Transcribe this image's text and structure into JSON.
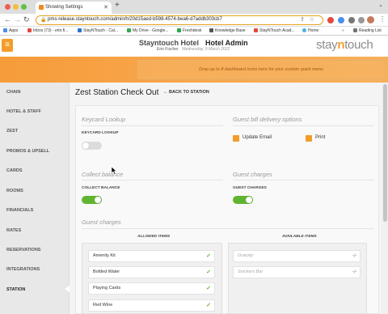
{
  "browser": {
    "tab_title": "Showing Settings",
    "url": "pms-release.stayntouch.com/admin/h/20d15aed-b598-4574-bea6-d7addb303cb7",
    "bookmarks": [
      "Apps",
      "Inbox (73) - erin.fi...",
      "StayNTouch - Cal...",
      "My Drive - Google...",
      "Freshdesk",
      "Knowledge Base",
      "StayNTouch Acad...",
      "Home",
      "Reading List"
    ]
  },
  "header": {
    "hotel_name": "Stayntouch Hotel",
    "admin_label": "Hotel Admin",
    "user_name": "Erin Fischer",
    "date": "Wednesday, 9 March 2022",
    "logo_prefix": "stay",
    "logo_n": "n",
    "logo_suffix": "touch",
    "banner_text": "Drop up to 8 dashboard icons here for your custom quick menu"
  },
  "sidebar": {
    "items": [
      "CHAIN",
      "HOTEL & STAFF",
      "ZEST",
      "PROMOS & UPSELL",
      "CARDS",
      "ROOMS",
      "FINANCIALS",
      "RATES",
      "RESERVATIONS",
      "INTEGRATIONS",
      "STATION"
    ],
    "active": "STATION"
  },
  "main": {
    "title": "Zest Station Check Out",
    "back_label": "BACK TO STATION",
    "keycard_section": "Keycard Lookup",
    "keycard_label": "KEYCARD LOOKUP",
    "keycard_on": false,
    "delivery_section": "Guest bill delivery options",
    "delivery_options": [
      "Update Email",
      "Print"
    ],
    "balance_section": "Collect balance",
    "balance_label": "COLLECT BALANCE",
    "balance_on": true,
    "charges_section": "Guest charges",
    "charges_label": "GUEST CHARGES",
    "charges_on": true,
    "charges_list_section": "Guest charges",
    "allowed_header": "ALLOWED ITEMS",
    "available_header": "AVAILABLE ITEMS",
    "allowed_items": [
      "Amenity Kit",
      "Bottled Water",
      "Playing Cards",
      "Red Wine"
    ],
    "available_items": [
      "Gratuity",
      "Snickers Bar"
    ]
  },
  "colors": {
    "accent": "#f39c2a",
    "toggle_on": "#5fb530"
  }
}
